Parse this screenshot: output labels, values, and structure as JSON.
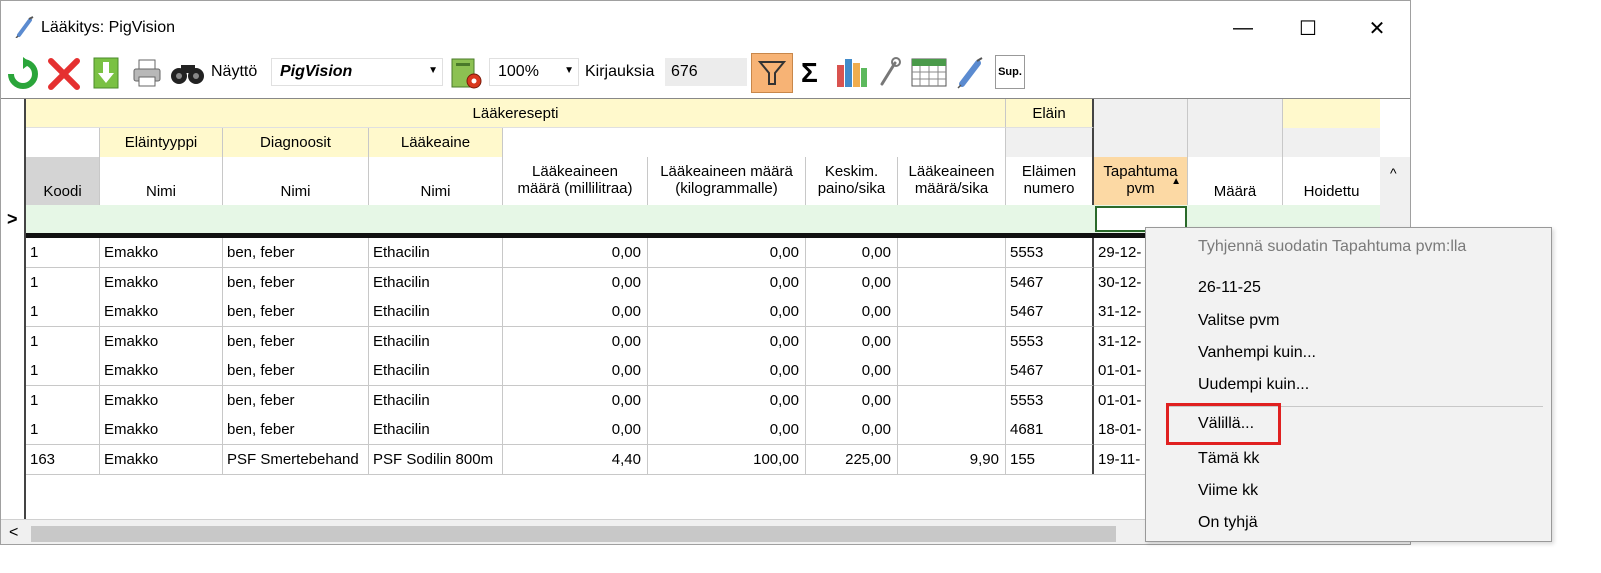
{
  "window": {
    "title": "Lääkitys: PigVision",
    "minimize_glyph": "—",
    "maximize_glyph": "☐",
    "close_glyph": "✕"
  },
  "toolbar": {
    "naytto_label": "Näyttö",
    "naytto_value": "PigVision",
    "zoom_value": "100%",
    "kirjauksia_label": "Kirjauksia",
    "kirjauksia_value": "676",
    "sigma_glyph": "Σ",
    "sup_label": "Sup."
  },
  "grid": {
    "group_headers": {
      "laakeresepti": "Lääkeresepti",
      "elain": "Eläin"
    },
    "sub_headers": {
      "elaintyyppi": "Eläintyyppi",
      "diagnoosit": "Diagnoosit",
      "laakeaine": "Lääkeaine"
    },
    "columns": [
      {
        "key": "koodi",
        "label": "Koodi"
      },
      {
        "key": "nimi1",
        "label": "Nimi"
      },
      {
        "key": "nimi2",
        "label": "Nimi"
      },
      {
        "key": "nimi3",
        "label": "Nimi"
      },
      {
        "key": "ml",
        "label_line1": "Lääkeaineen",
        "label_line2": "määrä (millilitraa)"
      },
      {
        "key": "kg",
        "label_line1": "Lääkeaineen määrä",
        "label_line2": "(kilogrammalle)"
      },
      {
        "key": "paino",
        "label_line1": "Keskim.",
        "label_line2": "paino/sika"
      },
      {
        "key": "persika",
        "label_line1": "Lääkeaineen",
        "label_line2": "määrä/sika"
      },
      {
        "key": "elainnro",
        "label_line1": "Eläimen",
        "label_line2": "numero"
      },
      {
        "key": "pvm",
        "label_line1": "Tapahtuma",
        "label_line2": "pvm"
      },
      {
        "key": "maara",
        "label": "Määrä"
      },
      {
        "key": "hoidettu",
        "label": "Hoidettu"
      }
    ],
    "filter_row_marker": ">",
    "rows": [
      [
        "1",
        "Emakko",
        "ben, feber",
        "Ethacilin",
        "0,00",
        "0,00",
        "0,00",
        "",
        "5553",
        "29-12-"
      ],
      [
        "1",
        "Emakko",
        "ben, feber",
        "Ethacilin",
        "0,00",
        "0,00",
        "0,00",
        "",
        "5467",
        "30-12-"
      ],
      [
        "1",
        "Emakko",
        "ben, feber",
        "Ethacilin",
        "0,00",
        "0,00",
        "0,00",
        "",
        "5467",
        "31-12-"
      ],
      [
        "1",
        "Emakko",
        "ben, feber",
        "Ethacilin",
        "0,00",
        "0,00",
        "0,00",
        "",
        "5553",
        "31-12-"
      ],
      [
        "1",
        "Emakko",
        "ben, feber",
        "Ethacilin",
        "0,00",
        "0,00",
        "0,00",
        "",
        "5467",
        "01-01-"
      ],
      [
        "1",
        "Emakko",
        "ben, feber",
        "Ethacilin",
        "0,00",
        "0,00",
        "0,00",
        "",
        "5553",
        "01-01-"
      ],
      [
        "1",
        "Emakko",
        "ben, feber",
        "Ethacilin",
        "0,00",
        "0,00",
        "0,00",
        "",
        "4681",
        "18-01-"
      ],
      [
        "163",
        "Emakko",
        "PSF Smertebehand",
        "PSF Sodilin 800m",
        "4,40",
        "100,00",
        "225,00",
        "9,90",
        "155",
        "19-11-"
      ]
    ],
    "scroll_up_glyph": "^",
    "scroll_left_glyph": "<"
  },
  "context_menu": {
    "items": [
      {
        "label": "Tyhjennä suodatin Tapahtuma pvm:lla",
        "disabled": true
      },
      {
        "label": "26-11-25"
      },
      {
        "label": "Valitse pvm"
      },
      {
        "label": "Vanhempi kuin..."
      },
      {
        "label": "Uudempi kuin..."
      },
      {
        "label": "Välillä...",
        "highlighted": true
      },
      {
        "label": "Tämä kk"
      },
      {
        "label": "Viime kk"
      },
      {
        "label": "On tyhjä"
      }
    ],
    "highlight_color": "#e02020"
  },
  "colors": {
    "header_yellow": "#fff9cc",
    "filter_row": "#e6f7e6",
    "sorted_header": "#fcd9a4",
    "active_button": "#f7b375"
  }
}
